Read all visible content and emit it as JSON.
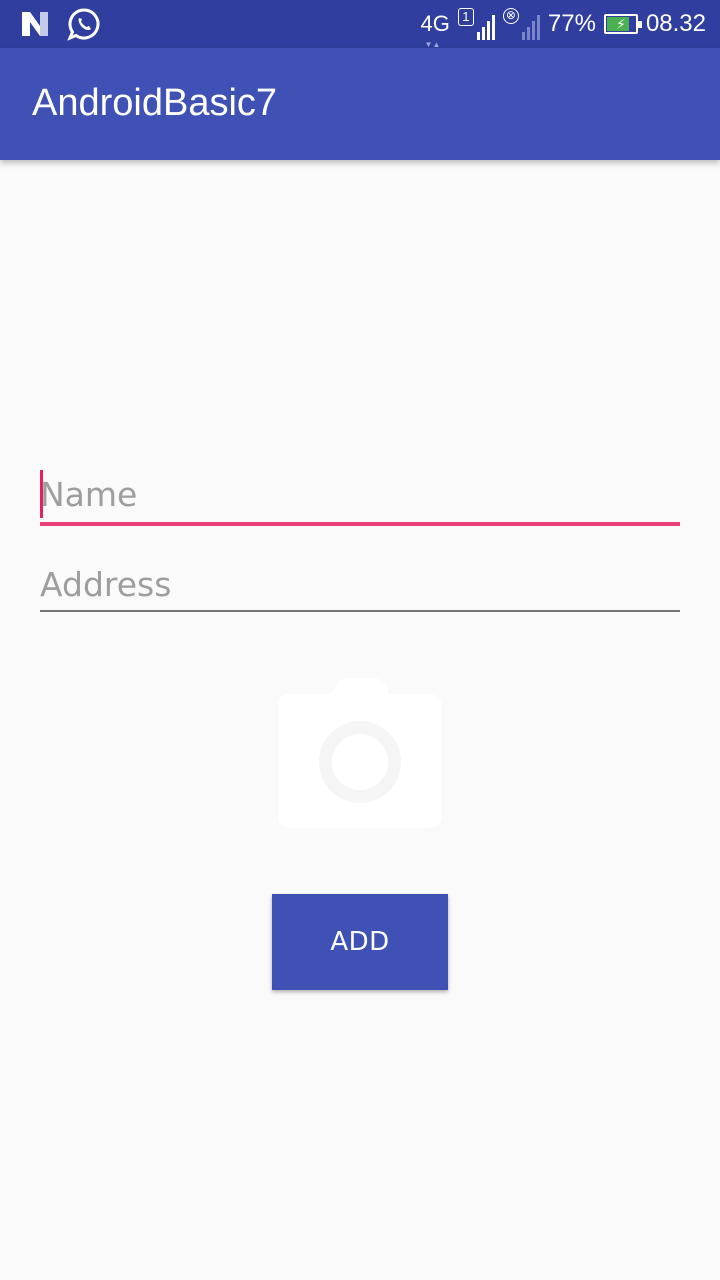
{
  "status_bar": {
    "left_icons": [
      "n-notification-icon",
      "whatsapp-icon"
    ],
    "network": "4G",
    "sim1_label": "1",
    "sim2_label": "⊗",
    "battery_percent": "77%",
    "battery_charging": true,
    "time": "08.32"
  },
  "app_bar": {
    "title": "AndroidBasic7"
  },
  "form": {
    "name_placeholder": "Name",
    "name_value": "",
    "address_placeholder": "Address",
    "address_value": "",
    "photo_icon": "camera-icon",
    "add_label": "ADD"
  },
  "colors": {
    "primary": "#3f51b5",
    "primary_dark": "#303f9f",
    "accent": "#ec407a",
    "background": "#fafafa"
  }
}
